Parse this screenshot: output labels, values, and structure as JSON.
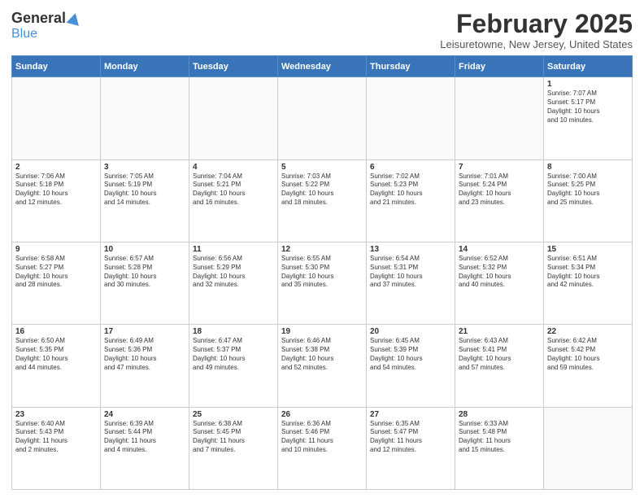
{
  "header": {
    "logo_general": "General",
    "logo_blue": "Blue",
    "title": "February 2025",
    "location": "Leisuretowne, New Jersey, United States"
  },
  "weekdays": [
    "Sunday",
    "Monday",
    "Tuesday",
    "Wednesday",
    "Thursday",
    "Friday",
    "Saturday"
  ],
  "weeks": [
    [
      {
        "day": "",
        "detail": ""
      },
      {
        "day": "",
        "detail": ""
      },
      {
        "day": "",
        "detail": ""
      },
      {
        "day": "",
        "detail": ""
      },
      {
        "day": "",
        "detail": ""
      },
      {
        "day": "",
        "detail": ""
      },
      {
        "day": "1",
        "detail": "Sunrise: 7:07 AM\nSunset: 5:17 PM\nDaylight: 10 hours\nand 10 minutes."
      }
    ],
    [
      {
        "day": "2",
        "detail": "Sunrise: 7:06 AM\nSunset: 5:18 PM\nDaylight: 10 hours\nand 12 minutes."
      },
      {
        "day": "3",
        "detail": "Sunrise: 7:05 AM\nSunset: 5:19 PM\nDaylight: 10 hours\nand 14 minutes."
      },
      {
        "day": "4",
        "detail": "Sunrise: 7:04 AM\nSunset: 5:21 PM\nDaylight: 10 hours\nand 16 minutes."
      },
      {
        "day": "5",
        "detail": "Sunrise: 7:03 AM\nSunset: 5:22 PM\nDaylight: 10 hours\nand 18 minutes."
      },
      {
        "day": "6",
        "detail": "Sunrise: 7:02 AM\nSunset: 5:23 PM\nDaylight: 10 hours\nand 21 minutes."
      },
      {
        "day": "7",
        "detail": "Sunrise: 7:01 AM\nSunset: 5:24 PM\nDaylight: 10 hours\nand 23 minutes."
      },
      {
        "day": "8",
        "detail": "Sunrise: 7:00 AM\nSunset: 5:25 PM\nDaylight: 10 hours\nand 25 minutes."
      }
    ],
    [
      {
        "day": "9",
        "detail": "Sunrise: 6:58 AM\nSunset: 5:27 PM\nDaylight: 10 hours\nand 28 minutes."
      },
      {
        "day": "10",
        "detail": "Sunrise: 6:57 AM\nSunset: 5:28 PM\nDaylight: 10 hours\nand 30 minutes."
      },
      {
        "day": "11",
        "detail": "Sunrise: 6:56 AM\nSunset: 5:29 PM\nDaylight: 10 hours\nand 32 minutes."
      },
      {
        "day": "12",
        "detail": "Sunrise: 6:55 AM\nSunset: 5:30 PM\nDaylight: 10 hours\nand 35 minutes."
      },
      {
        "day": "13",
        "detail": "Sunrise: 6:54 AM\nSunset: 5:31 PM\nDaylight: 10 hours\nand 37 minutes."
      },
      {
        "day": "14",
        "detail": "Sunrise: 6:52 AM\nSunset: 5:32 PM\nDaylight: 10 hours\nand 40 minutes."
      },
      {
        "day": "15",
        "detail": "Sunrise: 6:51 AM\nSunset: 5:34 PM\nDaylight: 10 hours\nand 42 minutes."
      }
    ],
    [
      {
        "day": "16",
        "detail": "Sunrise: 6:50 AM\nSunset: 5:35 PM\nDaylight: 10 hours\nand 44 minutes."
      },
      {
        "day": "17",
        "detail": "Sunrise: 6:49 AM\nSunset: 5:36 PM\nDaylight: 10 hours\nand 47 minutes."
      },
      {
        "day": "18",
        "detail": "Sunrise: 6:47 AM\nSunset: 5:37 PM\nDaylight: 10 hours\nand 49 minutes."
      },
      {
        "day": "19",
        "detail": "Sunrise: 6:46 AM\nSunset: 5:38 PM\nDaylight: 10 hours\nand 52 minutes."
      },
      {
        "day": "20",
        "detail": "Sunrise: 6:45 AM\nSunset: 5:39 PM\nDaylight: 10 hours\nand 54 minutes."
      },
      {
        "day": "21",
        "detail": "Sunrise: 6:43 AM\nSunset: 5:41 PM\nDaylight: 10 hours\nand 57 minutes."
      },
      {
        "day": "22",
        "detail": "Sunrise: 6:42 AM\nSunset: 5:42 PM\nDaylight: 10 hours\nand 59 minutes."
      }
    ],
    [
      {
        "day": "23",
        "detail": "Sunrise: 6:40 AM\nSunset: 5:43 PM\nDaylight: 11 hours\nand 2 minutes."
      },
      {
        "day": "24",
        "detail": "Sunrise: 6:39 AM\nSunset: 5:44 PM\nDaylight: 11 hours\nand 4 minutes."
      },
      {
        "day": "25",
        "detail": "Sunrise: 6:38 AM\nSunset: 5:45 PM\nDaylight: 11 hours\nand 7 minutes."
      },
      {
        "day": "26",
        "detail": "Sunrise: 6:36 AM\nSunset: 5:46 PM\nDaylight: 11 hours\nand 10 minutes."
      },
      {
        "day": "27",
        "detail": "Sunrise: 6:35 AM\nSunset: 5:47 PM\nDaylight: 11 hours\nand 12 minutes."
      },
      {
        "day": "28",
        "detail": "Sunrise: 6:33 AM\nSunset: 5:48 PM\nDaylight: 11 hours\nand 15 minutes."
      },
      {
        "day": "",
        "detail": ""
      }
    ]
  ]
}
